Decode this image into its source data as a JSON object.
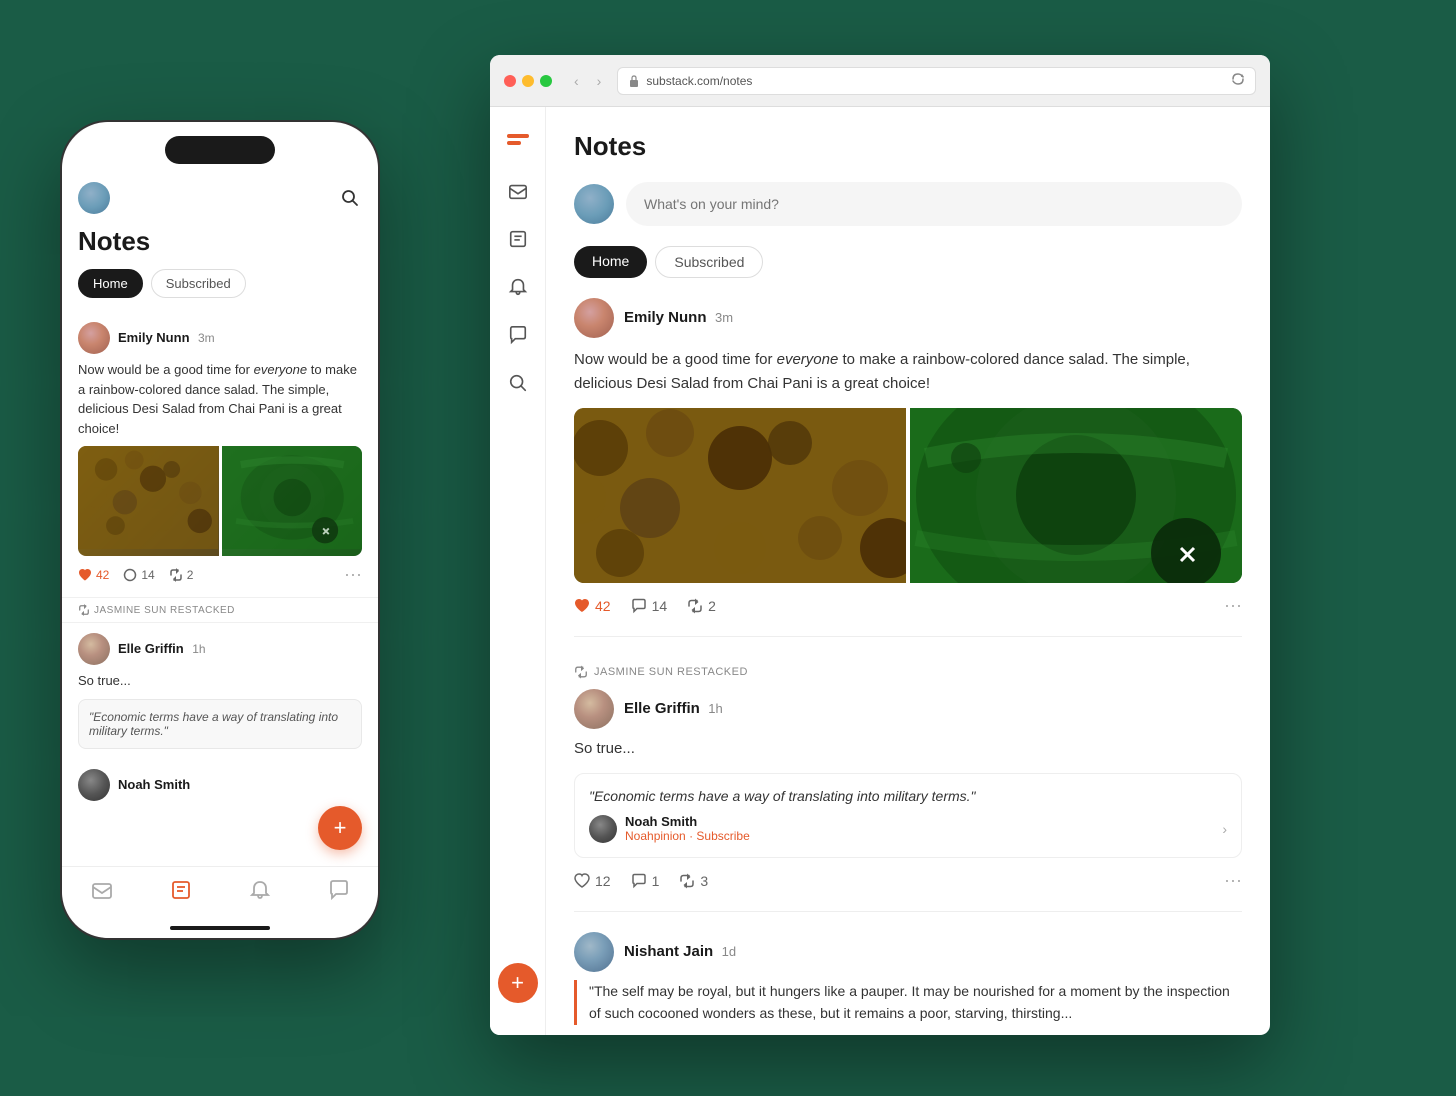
{
  "background": {
    "color": "#1a5c46"
  },
  "phone": {
    "title": "Notes",
    "tabs": [
      {
        "label": "Home",
        "active": true
      },
      {
        "label": "Subscribed",
        "active": false
      }
    ],
    "posts": [
      {
        "author": "Emily Nunn",
        "time": "3m",
        "text_part1": "Now would be a good time for ",
        "text_italic": "everyone",
        "text_part2": " to make a rainbow-colored dance salad. The simple, delicious Desi Salad from Chai Pani is a great choice!",
        "likes": "42",
        "comments": "14",
        "restacks": "2"
      }
    ],
    "restack_user": "JASMINE SUN RESTACKED",
    "post2": {
      "author": "Elle Griffin",
      "time": "1h",
      "text": "So true...",
      "quote": "\"Economic terms have a way of translating into military terms.\""
    },
    "post3_preview": {
      "author": "Noah Smith"
    },
    "nav_items": [
      "inbox",
      "notes",
      "bell",
      "chat"
    ],
    "nav_active": 1
  },
  "browser": {
    "url": "substack.com/notes",
    "title": "Notes",
    "compose_placeholder": "What's on your mind?",
    "tabs": [
      {
        "label": "Home",
        "active": true
      },
      {
        "label": "Subscribed",
        "active": false
      }
    ],
    "posts": [
      {
        "author": "Emily Nunn",
        "time": "3m",
        "text_part1": "Now would be a good time for ",
        "text_italic": "everyone",
        "text_part2": " to make a rainbow-colored dance salad. The simple, delicious Desi Salad from Chai Pani is a great choice!",
        "likes": "42",
        "comments": "14",
        "restacks": "2"
      }
    ],
    "restack_label": "JASMINE SUN RESTACKED",
    "post2": {
      "author": "Elle Griffin",
      "time": "1h",
      "text": "So true...",
      "quote": "\"Economic terms have a way of translating into military terms.\"",
      "quote_author": "Noah Smith",
      "quote_publication": "Noahpinion",
      "quote_cta": "Subscribe",
      "likes": "12",
      "comments": "1",
      "restacks": "3"
    },
    "post3": {
      "author": "Nishant Jain",
      "time": "1d",
      "quote_text": "\"The self may be royal, but it hungers like a pauper. It may be nourished for a moment by the inspection of such cocooned wonders as these, but it remains a poor, starving, thirsting..."
    }
  },
  "sidebar": {
    "items": [
      "inbox",
      "notes",
      "bell",
      "chat",
      "search"
    ]
  },
  "icons": {
    "search": "🔍",
    "inbox": "✉",
    "notes": "📋",
    "bell": "🔔",
    "chat": "💬",
    "like": "♥",
    "comment": "○",
    "restack": "↺",
    "more": "···",
    "plus": "+",
    "back": "‹",
    "forward": "›",
    "lock": "🔒",
    "reload": "↻",
    "chevron_right": "›"
  }
}
